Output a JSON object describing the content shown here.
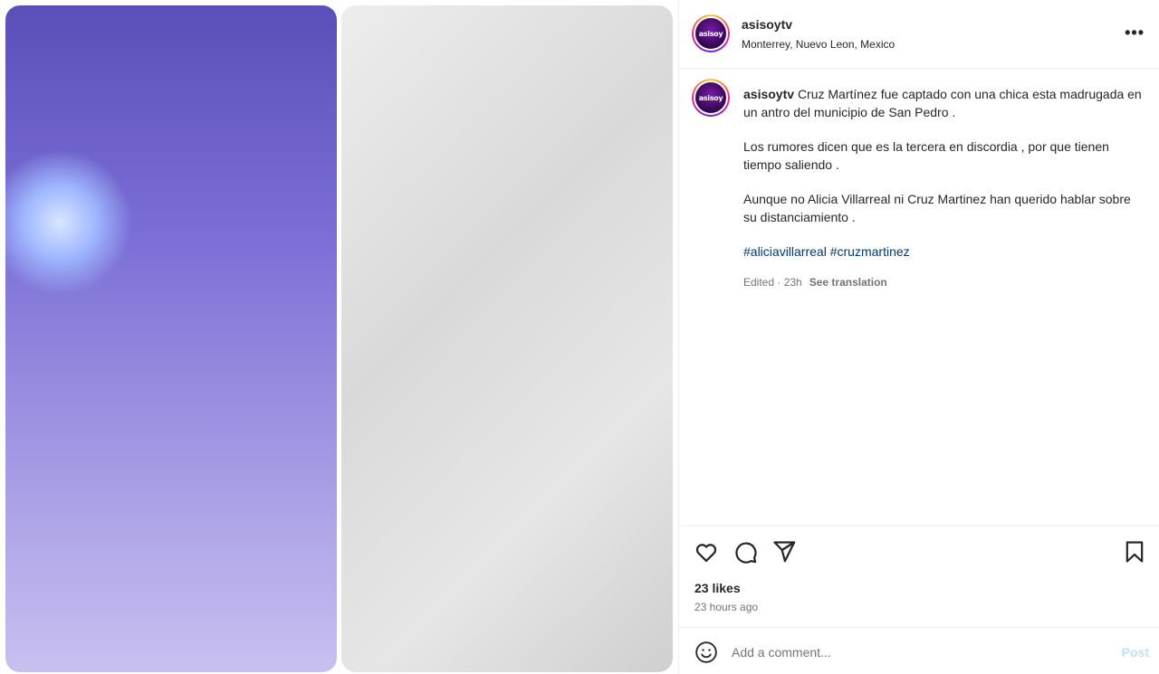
{
  "post": {
    "username": "asisoytv",
    "location": "Monterrey, Nuevo Leon, Mexico",
    "avatar_text": "asisoy",
    "more_label": "•••",
    "caption": {
      "username": "asisoytv",
      "paragraph1": "Cruz Martínez fue captado con una chica esta madrugada en un antro del municipio de San Pedro .",
      "paragraph2": "Los rumores dicen que es la tercera en discordia , por que tienen tiempo saliendo .",
      "paragraph3": "Aunque no Alicia Villarreal ni Cruz Martinez han querido hablar sobre su distanciamiento .",
      "hashtags": [
        "#aliciavillarreal",
        "#cruzmartinez"
      ],
      "edited": "Edited · 23h",
      "see_translation": "See translation"
    },
    "likes": "23 likes",
    "timestamp": "23 hours ago"
  },
  "comment": {
    "placeholder": "Add a comment...",
    "post_label": "Post"
  },
  "icons": [
    "like-icon",
    "comment-icon",
    "share-icon",
    "save-icon",
    "emoji-icon",
    "more-icon"
  ],
  "colors": {
    "text": "#262626",
    "secondary": "#737373",
    "link": "#00376b",
    "post_disabled": "#c0dffd",
    "border": "#efefef"
  }
}
